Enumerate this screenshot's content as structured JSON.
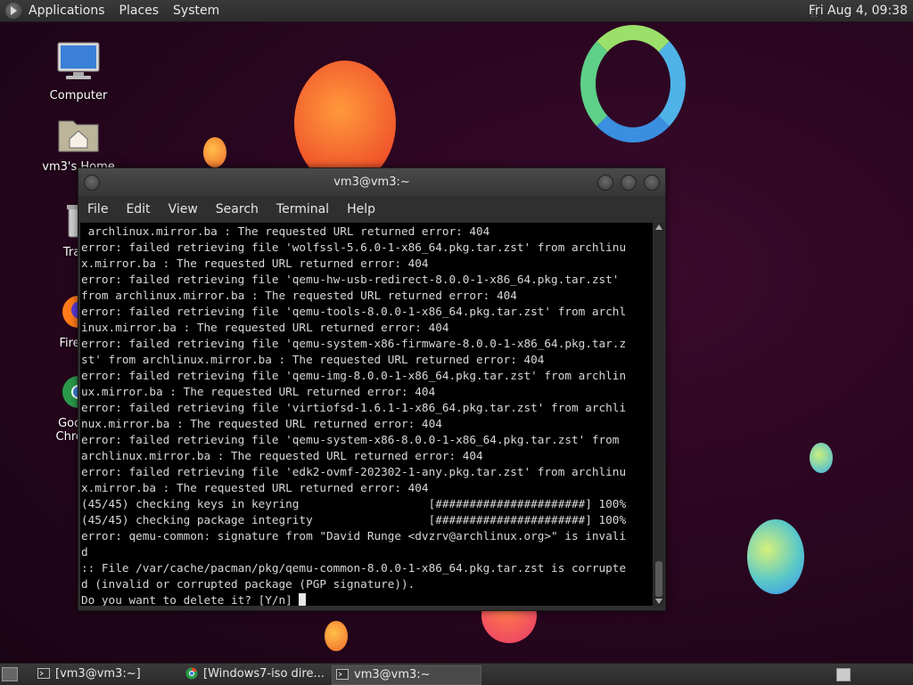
{
  "top_panel": {
    "menus": [
      "Applications",
      "Places",
      "System"
    ],
    "clock": "Fri Aug  4, 09:38"
  },
  "desktop": {
    "icons": [
      {
        "label": "Computer",
        "icon": "computer-icon"
      },
      {
        "label": "vm3's Home",
        "icon": "home-folder-icon"
      },
      {
        "label": "Trash",
        "icon": "trash-icon"
      },
      {
        "label": "Firefox",
        "icon": "firefox-icon"
      },
      {
        "label": "Google Chrome",
        "icon": "chrome-icon"
      }
    ]
  },
  "terminal": {
    "title": "vm3@vm3:~",
    "menu": [
      "File",
      "Edit",
      "View",
      "Search",
      "Terminal",
      "Help"
    ],
    "lines": [
      " archlinux.mirror.ba : The requested URL returned error: 404",
      "error: failed retrieving file 'wolfssl-5.6.0-1-x86_64.pkg.tar.zst' from archlinu",
      "x.mirror.ba : The requested URL returned error: 404",
      "error: failed retrieving file 'qemu-hw-usb-redirect-8.0.0-1-x86_64.pkg.tar.zst'",
      "from archlinux.mirror.ba : The requested URL returned error: 404",
      "error: failed retrieving file 'qemu-tools-8.0.0-1-x86_64.pkg.tar.zst' from archl",
      "inux.mirror.ba : The requested URL returned error: 404",
      "error: failed retrieving file 'qemu-system-x86-firmware-8.0.0-1-x86_64.pkg.tar.z",
      "st' from archlinux.mirror.ba : The requested URL returned error: 404",
      "error: failed retrieving file 'qemu-img-8.0.0-1-x86_64.pkg.tar.zst' from archlin",
      "ux.mirror.ba : The requested URL returned error: 404",
      "error: failed retrieving file 'virtiofsd-1.6.1-1-x86_64.pkg.tar.zst' from archli",
      "nux.mirror.ba : The requested URL returned error: 404",
      "error: failed retrieving file 'qemu-system-x86-8.0.0-1-x86_64.pkg.tar.zst' from",
      "archlinux.mirror.ba : The requested URL returned error: 404",
      "error: failed retrieving file 'edk2-ovmf-202302-1-any.pkg.tar.zst' from archlinu",
      "x.mirror.ba : The requested URL returned error: 404",
      "(45/45) checking keys in keyring                   [######################] 100%",
      "(45/45) checking package integrity                 [######################] 100%",
      "error: qemu-common: signature from \"David Runge <dvzrv@archlinux.org>\" is invali",
      "d",
      ":: File /var/cache/pacman/pkg/qemu-common-8.0.0-1-x86_64.pkg.tar.zst is corrupte",
      "d (invalid or corrupted package (PGP signature)).",
      "Do you want to delete it? [Y/n] "
    ]
  },
  "taskbar": {
    "tasks": [
      {
        "label": "[vm3@vm3:~]",
        "icon": "terminal-icon",
        "active": false
      },
      {
        "label": "[Windows7-iso dire...",
        "icon": "chrome-icon",
        "active": false
      },
      {
        "label": "vm3@vm3:~",
        "icon": "terminal-icon",
        "active": true
      }
    ]
  }
}
